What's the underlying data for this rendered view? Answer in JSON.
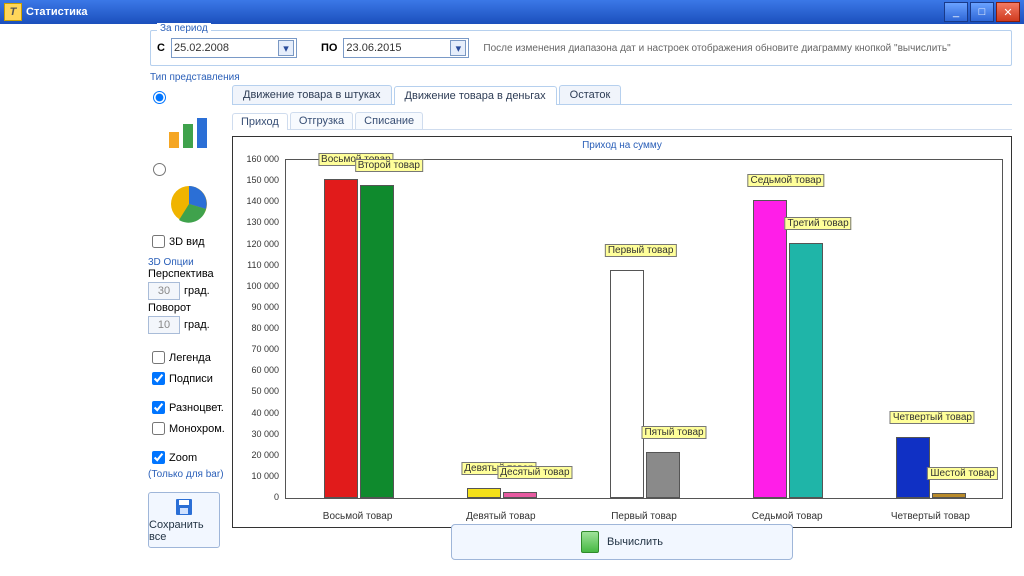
{
  "window": {
    "title": "Статистика"
  },
  "period": {
    "group_label": "За период",
    "from_label": "С",
    "from_value": "25.02.2008",
    "to_label": "ПО",
    "to_value": "23.06.2015",
    "hint": "После изменения диапазона дат и настроек отображения обновите диаграмму кнопкой \"вычислить\""
  },
  "left": {
    "section": "Тип представления",
    "view3d": "3D вид",
    "opts3d_title": "3D Опции",
    "perspective_label": "Перспектива",
    "perspective_val": "30",
    "deg": "град.",
    "rotate_label": "Поворот",
    "rotate_val": "10",
    "legend": "Легенда",
    "labels": "Подписи",
    "multicolor": "Разноцвет.",
    "mono": "Монохром.",
    "zoom": "Zoom",
    "zoom_note": "(Только для bar)",
    "save": "Сохранить все"
  },
  "tabs": {
    "top": [
      "Движение товара в штуках",
      "Движение товара в деньгах",
      "Остаток"
    ],
    "active_top": 1,
    "sub": [
      "Приход",
      "Отгрузка",
      "Списание"
    ],
    "active_sub": 0
  },
  "compute_label": "Вычислить",
  "chart_data": {
    "type": "bar",
    "title": "Приход на сумму",
    "ylim": [
      0,
      160000
    ],
    "ytick_step": 10000,
    "x_groups": [
      "Восьмой товар",
      "Девятый товар",
      "Первый товар",
      "Седьмой товар",
      "Четвертый товар"
    ],
    "series": [
      {
        "name": "Восьмой товар",
        "value": 150000,
        "color": "#e11b1b",
        "group": 0,
        "slot": 0
      },
      {
        "name": "Второй товар",
        "value": 147000,
        "color": "#0f8a2d",
        "group": 0,
        "slot": 1
      },
      {
        "name": "Девятый товар",
        "value": 4000,
        "color": "#f5e11a",
        "group": 1,
        "slot": 0
      },
      {
        "name": "Десятый товар",
        "value": 2000,
        "color": "#e65aa0",
        "group": 1,
        "slot": 1
      },
      {
        "name": "Первый товар",
        "value": 107000,
        "color": "#ffffff",
        "group": 2,
        "slot": 0
      },
      {
        "name": "Пятый товар",
        "value": 21000,
        "color": "#8a8a8a",
        "group": 2,
        "slot": 1
      },
      {
        "name": "Седьмой товар",
        "value": 140000,
        "color": "#ff1ee8",
        "group": 3,
        "slot": 0
      },
      {
        "name": "Третий товар",
        "value": 120000,
        "color": "#1fb5a8",
        "group": 3,
        "slot": 1
      },
      {
        "name": "Четвертый товар",
        "value": 28000,
        "color": "#1030c4",
        "group": 4,
        "slot": 0
      },
      {
        "name": "Шестой товар",
        "value": 1500,
        "color": "#b88a2a",
        "group": 4,
        "slot": 1
      }
    ]
  }
}
